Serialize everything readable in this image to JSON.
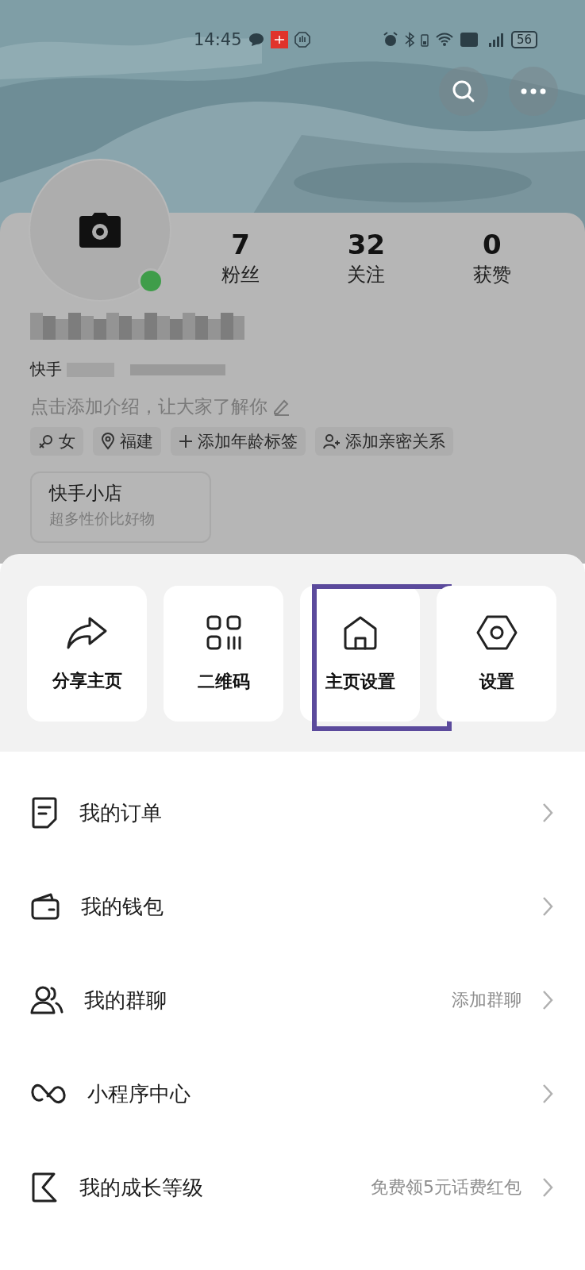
{
  "status_bar": {
    "time": "14:45",
    "battery": "56"
  },
  "profile": {
    "online": true,
    "stats": [
      {
        "value": "7",
        "label": "粉丝"
      },
      {
        "value": "32",
        "label": "关注"
      },
      {
        "value": "0",
        "label": "获赞"
      }
    ],
    "account_prefix": "快手",
    "intro": "点击添加介绍，让大家了解你",
    "tags": [
      {
        "kind": "gender",
        "label": "女"
      },
      {
        "kind": "location",
        "label": "福建"
      },
      {
        "kind": "add",
        "label": "添加年龄标签"
      },
      {
        "kind": "relation",
        "label": "添加亲密关系"
      }
    ],
    "shop": {
      "title": "快手小店",
      "subtitle": "超多性价比好物"
    }
  },
  "sheet": {
    "tiles": [
      {
        "kind": "share",
        "label": "分享主页",
        "highlighted": false
      },
      {
        "kind": "qr",
        "label": "二维码",
        "highlighted": false
      },
      {
        "kind": "home",
        "label": "主页设置",
        "highlighted": true
      },
      {
        "kind": "settings",
        "label": "设置",
        "highlighted": false
      }
    ],
    "menu": [
      {
        "kind": "order",
        "label": "我的订单"
      },
      {
        "kind": "wallet",
        "label": "我的钱包"
      },
      {
        "kind": "group",
        "label": "我的群聊",
        "hint": "添加群聊"
      },
      {
        "kind": "miniapp",
        "label": "小程序中心"
      },
      {
        "kind": "level",
        "label": "我的成长等级",
        "hint": "免费领5元话费红包"
      }
    ]
  }
}
